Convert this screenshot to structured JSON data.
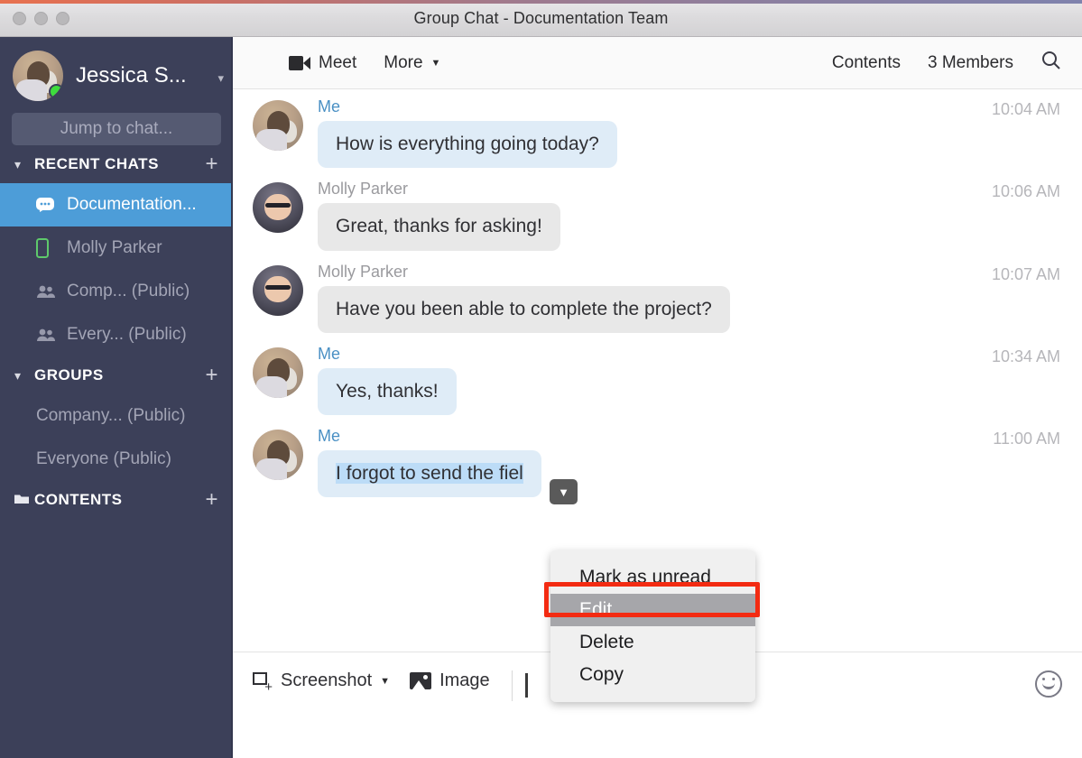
{
  "window": {
    "title": "Group Chat - Documentation Team",
    "traffic_lights": [
      "close",
      "minimize",
      "zoom"
    ]
  },
  "sidebar": {
    "user": {
      "name": "Jessica S...",
      "status": "online",
      "status_color": "#3ddc3d",
      "caret_icon": "chevron-down-icon"
    },
    "jump_to_chat": {
      "placeholder": "Jump to chat..."
    },
    "sections": [
      {
        "key": "recent_chats",
        "label": "RECENT CHATS",
        "chevron_icon": "chevron-down-icon",
        "add_icon": "plus-icon",
        "items": [
          {
            "label": "Documentation...",
            "icon": "chat-bubble-icon",
            "selected": true
          },
          {
            "label": "Molly Parker",
            "icon": "mobile-phone-icon",
            "selected": false
          },
          {
            "label": "Comp... (Public)",
            "icon": "group-people-icon",
            "selected": false
          },
          {
            "label": "Every... (Public)",
            "icon": "group-people-icon",
            "selected": false
          }
        ]
      },
      {
        "key": "groups",
        "label": "GROUPS",
        "chevron_icon": "chevron-down-icon",
        "add_icon": "plus-icon",
        "items": [
          {
            "label": "Company... (Public)",
            "icon": "",
            "selected": false
          },
          {
            "label": "Everyone (Public)",
            "icon": "",
            "selected": false
          }
        ]
      },
      {
        "key": "contents",
        "label": "CONTENTS",
        "chevron_icon": "folder-icon",
        "add_icon": "plus-icon",
        "items": []
      }
    ],
    "colors": {
      "background": "#3c4059",
      "selected": "#4d9dd8",
      "muted_text": "#a3a5b6"
    }
  },
  "toolbar": {
    "meet_label": "Meet",
    "meet_icon": "video-camera-icon",
    "more_label": "More",
    "more_caret_icon": "caret-down-icon",
    "contents_label": "Contents",
    "members_label": "3 Members",
    "search_icon": "search-icon"
  },
  "messages": [
    {
      "sender": "Me",
      "sender_type": "me",
      "avatar": "jessica-avatar",
      "text": "How is everything going today?",
      "time": "10:04 AM"
    },
    {
      "sender": "Molly Parker",
      "sender_type": "other",
      "avatar": "molly-avatar",
      "text": "Great, thanks for asking!",
      "time": "10:06 AM"
    },
    {
      "sender": "Molly Parker",
      "sender_type": "other",
      "avatar": "molly-avatar",
      "text": "Have you been able to complete the project?",
      "time": "10:07 AM"
    },
    {
      "sender": "Me",
      "sender_type": "me",
      "avatar": "jessica-avatar",
      "text": "Yes, thanks!",
      "time": "10:34 AM"
    },
    {
      "sender": "Me",
      "sender_type": "me",
      "avatar": "jessica-avatar",
      "text": "I forgot to send the fiel",
      "time": "11:00 AM",
      "selected": true
    }
  ],
  "message_actions": {
    "toggle_icon": "chevron-down-icon",
    "menu_items": [
      {
        "label": "Mark as unread",
        "active": false
      },
      {
        "label": "Edit",
        "active": true
      },
      {
        "label": "Delete",
        "active": false
      },
      {
        "label": "Copy",
        "active": false
      }
    ],
    "highlight_color": "#f32b12"
  },
  "composer": {
    "screenshot_label": "Screenshot",
    "screenshot_icon": "screenshot-icon",
    "screenshot_caret_icon": "caret-down-icon",
    "image_label": "Image",
    "image_icon": "image-icon",
    "emoji_icon": "smiley-face-icon",
    "input_value": ""
  }
}
